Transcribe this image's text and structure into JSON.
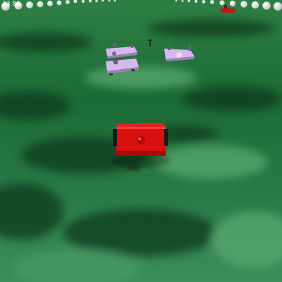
{
  "hud": {
    "counter": "43 80"
  },
  "scene": {
    "ground_colors": [
      "#3a8f4e",
      "#1f6b38",
      "#0c3b1c",
      "#5aa870"
    ],
    "player_car_color": "#d81010",
    "enemy_car_color": "#c8a8e8",
    "far_car_color": "#c01818",
    "boundary_ball_color": "#ffffff",
    "icons": [
      "boundary-ball-icon",
      "player-car-icon",
      "enemy-car-icon"
    ]
  }
}
